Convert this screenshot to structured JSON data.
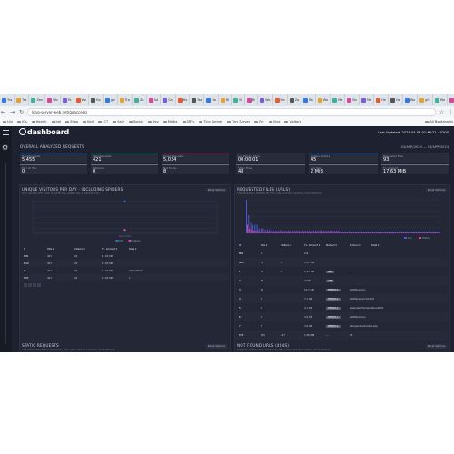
{
  "browser": {
    "tabs": [
      "Tra",
      "Tra",
      "Zen",
      "Wo",
      "Ps",
      "Wo",
      "Ho",
      "gw",
      "Tra",
      "Zo",
      "Ad",
      "Cal",
      "Ho",
      "Na",
      "Ho",
      "Bi",
      "Bi",
      "Bi",
      "Wo",
      "Ma",
      "Zo",
      "Ba",
      "Wo",
      "Ma",
      "Bu",
      "Ma",
      "He",
      "He",
      "Wo",
      "gfx",
      "Wo",
      "Ma",
      "Ma"
    ],
    "url": "long-server-web.net/goaccess/",
    "bookmarks": [
      "Uni",
      "IOs",
      "Health",
      "Irel",
      "Shop",
      "Kort",
      "ICT",
      "Sale",
      "Social",
      "Dev",
      "Media",
      "SRTv",
      "Tiny Server",
      "Tiny Server",
      "Fer",
      "Viva",
      "Visitors"
    ],
    "all_bookmarks": "All Bookmarks"
  },
  "app": {
    "logo": "dashboard",
    "last_updated": "Last Updated: 2024-04-03 01:46:21 +0200",
    "section_title": "OVERALL ANALYZED REQUESTS",
    "date_range": "03/APR/2024 — 03/APR/2024"
  },
  "metrics": [
    {
      "label": "Total Requests",
      "value": "5,455",
      "color": "#4b8fd9"
    },
    {
      "label": "Valid Requests",
      "value": "421",
      "color": "#3fb29a"
    },
    {
      "label": "Failed Requests",
      "value": "5,034",
      "color": "#d96aa6"
    },
    {
      "label": "Log Parsing Time",
      "value": "00:00:01",
      "color": "#6a6f82"
    },
    {
      "label": "Unique Visitors",
      "value": "45",
      "color": "#4b8fd9"
    },
    {
      "label": "Requested Files",
      "value": "93",
      "color": "#6a6f82"
    },
    {
      "label": "Excl. IP Hits",
      "value": "0",
      "color": "#6a6f82"
    },
    {
      "label": "Referrers",
      "value": "0",
      "color": "#6a6f82"
    },
    {
      "label": "Not Found",
      "value": "8",
      "color": "#6a6f82"
    },
    {
      "label": "Static Files",
      "value": "48",
      "color": "#6a6f82"
    },
    {
      "label": "Log Size",
      "value": "2 MiB",
      "color": "#6a6f82"
    },
    {
      "label": "Tx. Amount",
      "value": "17.63 MiB",
      "color": "#6a6f82"
    }
  ],
  "visitors_panel": {
    "title": "UNIQUE VISITORS PER DAY - INCLUDING SPIDERS",
    "subtitle": "HITS HAVING THE SAME IP, DATE AND AGENT ARE A UNIQUE VISIT",
    "options": "Panel Options",
    "headers": [
      "#",
      "Hits",
      "Visitors",
      "Tx. Amount",
      "Data"
    ],
    "rows": [
      [
        "MIN",
        "421",
        "45",
        "17.63 MiB",
        ""
      ],
      [
        "MAX",
        "421",
        "45",
        "17.63 MiB",
        ""
      ],
      [
        "1",
        "421",
        "45",
        "17.63 MiB",
        "3/Apr/2024"
      ]
    ],
    "total": [
      "TOT.",
      "421",
      "45",
      "17.63 MiB",
      "1"
    ],
    "legend": [
      "Hits",
      "Visitors"
    ]
  },
  "files_panel": {
    "title": "REQUESTED FILES (URLS)",
    "subtitle": "TOP REQUESTS SORTED BY HITS (AND VISITOR COUNTS) WITH METHOD",
    "options": "Panel Options",
    "headers": [
      "#",
      "Hits",
      "Visitors",
      "Tx. Amount",
      "Method",
      "Protocol",
      "Data"
    ],
    "rows": [
      [
        "MIN",
        "1",
        "1",
        "0 B",
        "",
        ""
      ],
      [
        "MAX",
        "35",
        "9",
        "1.47 MiB",
        "",
        ""
      ],
      [
        "1",
        "35",
        "9",
        "1.47 MiB",
        "GET",
        "/"
      ],
      [
        "2",
        "19",
        "",
        "3 KiB",
        "GET",
        ""
      ],
      [
        "3",
        "11",
        "",
        "10.7 KiB",
        "HTTP/1.1",
        "/ADDSolarAcc"
      ],
      [
        "4",
        "9",
        "",
        "7.1 KiB",
        "HTTP/1.1",
        "/ADDSolarAccControl"
      ],
      [
        "5",
        "9",
        "",
        "4.1 KiB",
        "HTTP/1.1",
        "/webview/?temperatureId=8"
      ],
      [
        "6",
        "9",
        "",
        "3.0 KiB",
        "HTTP/1.1",
        "/ADDSolarAcc"
      ],
      [
        "7",
        "5",
        "",
        "3.6 KiB",
        "HTTP/1.1",
        "/temperature/index.php"
      ]
    ],
    "total": [
      "TOT.",
      "155",
      "127",
      "1.06 MiB",
      "—",
      "93"
    ],
    "legend": [
      "Hits",
      "Visitors"
    ]
  },
  "static_panel": {
    "title": "STATIC REQUESTS",
    "subtitle": "TOP STATIC REQUESTS SORTED BY HITS (AND VISITOR COUNTS) WITH METHOD",
    "options": "Panel Options"
  },
  "notfound_panel": {
    "title": "NOT FOUND URLS (404S)",
    "subtitle": "TOP NOT FOUND URLS SORTED BY HITS (AND VISITOR COUNTS) WITH METHOD",
    "options": "Panel Options"
  },
  "chart_data": [
    {
      "type": "line",
      "title": "UNIQUE VISITORS PER DAY - INCLUDING SPIDERS",
      "categories": [
        "3/Apr/2024"
      ],
      "series": [
        {
          "name": "Hits",
          "values": [
            421
          ],
          "color": "#3b6fd0"
        },
        {
          "name": "Visitors",
          "values": [
            45
          ],
          "color": "#d9479a"
        }
      ]
    },
    {
      "type": "bar",
      "title": "REQUESTED FILES (URLS)",
      "ylim": [
        0,
        35
      ],
      "series": [
        {
          "name": "Hits",
          "color": "#4b5bd9",
          "values": [
            35,
            19,
            11,
            9,
            9,
            9,
            5,
            5,
            5,
            4,
            4,
            4,
            3,
            3,
            3,
            3,
            3,
            3,
            3,
            3,
            3,
            3,
            3,
            3,
            3,
            3,
            3,
            3,
            3,
            3,
            3,
            3,
            3,
            3,
            3,
            3,
            3,
            3,
            3,
            3,
            3,
            3,
            3,
            3,
            3,
            2,
            2,
            2,
            2,
            2,
            2,
            2,
            2,
            2,
            2,
            2,
            2,
            2,
            2,
            2,
            2,
            2,
            2,
            2,
            2,
            2,
            2,
            2,
            2,
            2,
            2,
            2,
            2,
            2,
            2,
            2,
            2,
            2,
            2,
            2,
            2,
            2,
            2,
            2,
            2,
            2,
            2,
            2,
            2,
            2,
            2,
            2,
            2
          ]
        },
        {
          "name": "Visitors",
          "color": "#d9479a",
          "values": [
            9,
            5,
            4,
            3,
            3,
            3,
            2,
            2,
            2,
            2,
            2,
            2,
            2,
            2,
            2,
            2,
            2,
            2,
            2,
            2,
            2,
            2,
            2,
            2,
            2,
            2,
            2,
            2,
            2,
            2,
            2,
            2,
            2,
            2,
            2,
            2,
            2,
            2,
            2,
            2,
            2,
            2,
            2,
            2,
            2,
            1,
            1,
            1,
            1,
            1,
            1,
            1,
            1,
            1,
            1,
            1,
            1,
            1,
            1,
            1,
            1,
            1,
            1,
            1,
            1,
            1,
            1,
            1,
            1,
            1,
            1,
            1,
            1,
            1,
            1,
            1,
            1,
            1,
            1,
            1,
            1,
            1,
            1,
            1,
            1,
            1,
            1,
            1,
            1,
            1,
            1,
            1,
            1
          ]
        }
      ]
    }
  ]
}
